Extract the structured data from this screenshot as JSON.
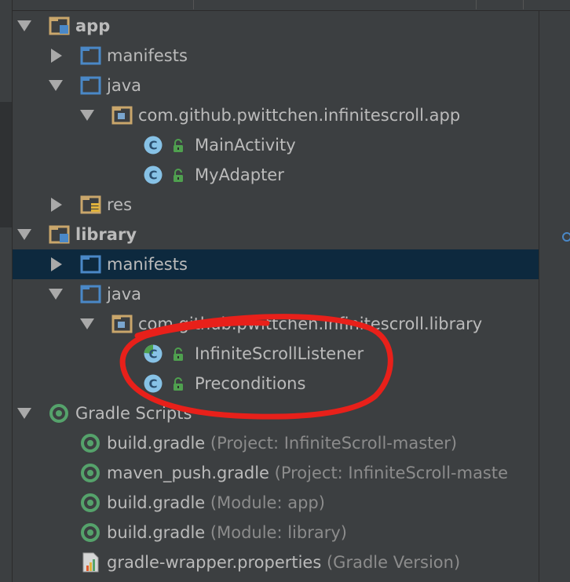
{
  "tree": [
    {
      "label": "app",
      "hint": "",
      "bold": true,
      "expanded": true,
      "has_arrow": true,
      "icon": "module-folder-icon",
      "depth": 0
    },
    {
      "label": "manifests",
      "hint": "",
      "bold": false,
      "expanded": false,
      "has_arrow": true,
      "icon": "folder-icon",
      "depth": 1
    },
    {
      "label": "java",
      "hint": "",
      "bold": false,
      "expanded": true,
      "has_arrow": true,
      "icon": "folder-icon",
      "depth": 1
    },
    {
      "label": "com.github.pwittchen.infinitescroll.app",
      "hint": "",
      "bold": false,
      "expanded": true,
      "has_arrow": true,
      "icon": "package-icon",
      "depth": 2
    },
    {
      "label": "MainActivity",
      "hint": "",
      "bold": false,
      "has_arrow": false,
      "icon": "class-icon",
      "depth": 3
    },
    {
      "label": "MyAdapter",
      "hint": "",
      "bold": false,
      "has_arrow": false,
      "icon": "class-icon",
      "depth": 3
    },
    {
      "label": "res",
      "hint": "",
      "bold": false,
      "expanded": false,
      "has_arrow": true,
      "icon": "res-folder-icon",
      "depth": 1
    },
    {
      "label": "library",
      "hint": "",
      "bold": true,
      "expanded": true,
      "has_arrow": true,
      "icon": "module-folder-icon",
      "depth": 0
    },
    {
      "label": "manifests",
      "hint": "",
      "bold": false,
      "expanded": false,
      "has_arrow": true,
      "icon": "folder-icon",
      "depth": 1,
      "selected": true
    },
    {
      "label": "java",
      "hint": "",
      "bold": false,
      "expanded": true,
      "has_arrow": true,
      "icon": "folder-icon",
      "depth": 1
    },
    {
      "label": "com.github.pwittchen.infinitescroll.library",
      "hint": "",
      "bold": false,
      "expanded": true,
      "has_arrow": true,
      "icon": "package-icon",
      "depth": 2
    },
    {
      "label": "InfiniteScrollListener",
      "hint": "",
      "bold": false,
      "has_arrow": false,
      "icon": "interface-icon",
      "depth": 3
    },
    {
      "label": "Preconditions",
      "hint": "",
      "bold": false,
      "has_arrow": false,
      "icon": "class-icon",
      "depth": 3
    },
    {
      "label": "Gradle Scripts",
      "hint": "",
      "bold": false,
      "expanded": true,
      "has_arrow": true,
      "icon": "gradle-scripts-icon",
      "depth": 0
    },
    {
      "label": "build.gradle",
      "hint": " (Project: InfiniteScroll-master)",
      "bold": false,
      "has_arrow": false,
      "icon": "gradle-file-icon",
      "depth": 1
    },
    {
      "label": "maven_push.gradle",
      "hint": " (Project: InfiniteScroll-maste",
      "bold": false,
      "has_arrow": false,
      "icon": "gradle-file-icon",
      "depth": 1
    },
    {
      "label": "build.gradle",
      "hint": " (Module: app)",
      "bold": false,
      "has_arrow": false,
      "icon": "gradle-file-icon",
      "depth": 1
    },
    {
      "label": "build.gradle",
      "hint": " (Module: library)",
      "bold": false,
      "has_arrow": false,
      "icon": "gradle-file-icon",
      "depth": 1
    },
    {
      "label": "gradle-wrapper.properties",
      "hint": " (Gradle Version)",
      "bold": false,
      "has_arrow": false,
      "icon": "properties-file-icon",
      "depth": 1
    }
  ],
  "colors": {
    "background": "#3c3f41",
    "selection": "#0d293e",
    "folder_blue": "#4a88c7",
    "class_badge": "#87c2e6",
    "lock_green": "#4fa04f",
    "annotation_red": "#e8201a"
  }
}
